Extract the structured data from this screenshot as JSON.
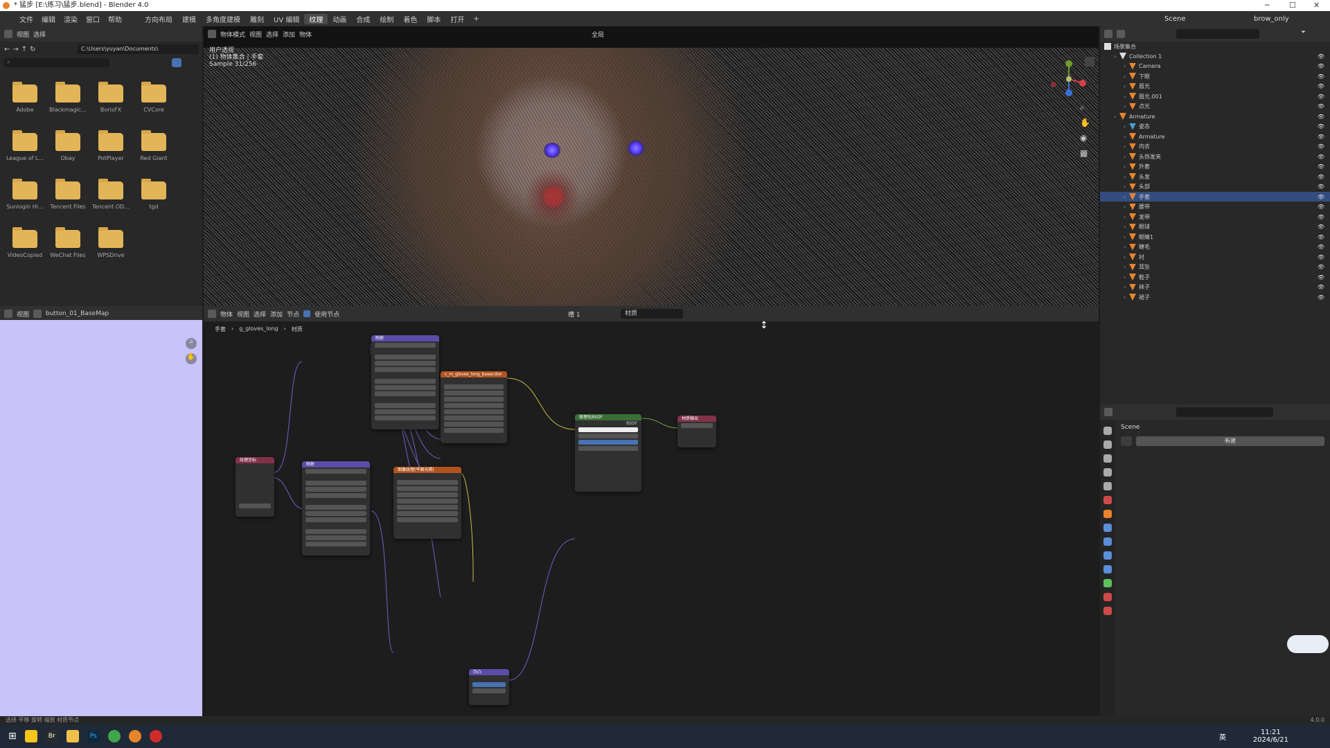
{
  "titlebar": {
    "title": "* 猛步 [E:\\练习\\猛步.blend] - Blender 4.0",
    "minimize": "─",
    "maximize": "☐",
    "close": "✕"
  },
  "menubar": {
    "items": [
      "文件",
      "编辑",
      "渲染",
      "窗口",
      "帮助"
    ],
    "workspaces": [
      "方向布局",
      "建模",
      "多角度建模",
      "雕刻",
      "UV 编辑",
      "纹理",
      "动画",
      "合成",
      "绘制",
      "着色",
      "脚本",
      "打开"
    ],
    "active_workspace": "纹理",
    "scene_label": "Scene",
    "layer_label": "brow_only"
  },
  "filebrowser": {
    "header": [
      "视图",
      "选择"
    ],
    "path": "C:\\Users\\yuyan\\Documents\\",
    "folders": [
      "Adobe",
      "Blackmagic...",
      "BorisFX",
      "CVCore",
      "League of L...",
      "Obay",
      "PotPlayer",
      "Red Giant",
      "Sunlogin Hi...",
      "Tencent Files",
      "Tencent OD...",
      "tgd",
      "VideoCopied",
      "WeChat Files",
      "WPSDrive"
    ]
  },
  "viewport": {
    "header": [
      "物体模式",
      "视图",
      "选择",
      "添加",
      "物体"
    ],
    "transform": "全局",
    "info": [
      "用户透视",
      "(1) 物体集合 | 手套",
      "Sample 31/256"
    ]
  },
  "outliner": {
    "root": "场景集合",
    "rows": [
      {
        "label": "Collection 1",
        "indent": 1,
        "icon": "collection-icon"
      },
      {
        "label": "Camera",
        "indent": 2,
        "icon": "camera-icon"
      },
      {
        "label": "下眼",
        "indent": 2,
        "icon": "mesh-icon"
      },
      {
        "label": "眉光",
        "indent": 2,
        "icon": "mesh-icon"
      },
      {
        "label": "眉光.001",
        "indent": 2,
        "icon": "mesh-icon"
      },
      {
        "label": "点光",
        "indent": 2,
        "icon": "light-icon"
      },
      {
        "label": "Armature",
        "indent": 1,
        "icon": "armature-icon"
      },
      {
        "label": "姿态",
        "indent": 2,
        "icon": "pose-icon"
      },
      {
        "label": "Armature",
        "indent": 2,
        "icon": "armature-icon"
      },
      {
        "label": "内衣",
        "indent": 2,
        "icon": "mesh-icon"
      },
      {
        "label": "头饰发夹",
        "indent": 2,
        "icon": "mesh-icon"
      },
      {
        "label": "外套",
        "indent": 2,
        "icon": "mesh-icon"
      },
      {
        "label": "头发",
        "indent": 2,
        "icon": "mesh-icon"
      },
      {
        "label": "头部",
        "indent": 2,
        "icon": "mesh-icon"
      },
      {
        "label": "手套",
        "indent": 2,
        "icon": "mesh-icon",
        "selected": true
      },
      {
        "label": "腰带",
        "indent": 2,
        "icon": "mesh-icon"
      },
      {
        "label": "发带",
        "indent": 2,
        "icon": "mesh-icon"
      },
      {
        "label": "眼球",
        "indent": 2,
        "icon": "mesh-icon"
      },
      {
        "label": "眼睛1",
        "indent": 2,
        "icon": "mesh-icon"
      },
      {
        "label": "睫毛",
        "indent": 2,
        "icon": "mesh-icon"
      },
      {
        "label": "衬",
        "indent": 2,
        "icon": "mesh-icon"
      },
      {
        "label": "耳坠",
        "indent": 2,
        "icon": "mesh-icon"
      },
      {
        "label": "鞋子",
        "indent": 2,
        "icon": "mesh-icon"
      },
      {
        "label": "袜子",
        "indent": 2,
        "icon": "mesh-icon"
      },
      {
        "label": "裙子",
        "indent": 2,
        "icon": "mesh-icon"
      }
    ]
  },
  "properties": {
    "scene": "Scene",
    "new_button": "新建"
  },
  "imageeditor": {
    "header_view": "视图",
    "image_name": "button_01_BaseMap"
  },
  "nodeeditor": {
    "header": [
      "物体",
      "视图",
      "选择",
      "添加",
      "节点"
    ],
    "use_nodes": "使用节点",
    "slot": "槽 1",
    "material": "材质",
    "breadcrumb": [
      "手套",
      "g_gloves_long",
      "材质"
    ],
    "nodes": {
      "mapping1": "映射",
      "image": "c_m_gloves_long_basecolor",
      "bsdf": "原理化BSDF",
      "output": "材质输出",
      "texcoord": "纹理坐标",
      "mapping2": "映射",
      "image2": "图像纹理(平面光照)",
      "noise": "凹凸"
    },
    "bsdf_label": "BSDF"
  },
  "statusbar": {
    "left": "选择   平移   旋转   缩放    材质节点",
    "version": "4.0.0"
  },
  "taskbar": {
    "time": "11:21",
    "date": "2024/6/21",
    "lang": "英"
  },
  "colors": {
    "selection": "#334d80",
    "accent": "#5680c2",
    "node_input": "#83314a",
    "node_shader": "#3a6e36",
    "node_texture": "#b0541f",
    "node_vector": "#5a4da8"
  }
}
